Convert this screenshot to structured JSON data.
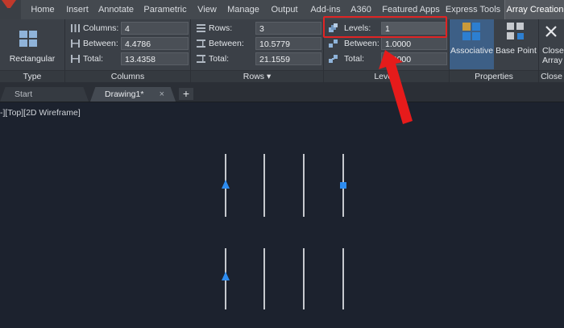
{
  "tabs": [
    {
      "label": "Home"
    },
    {
      "label": "Insert"
    },
    {
      "label": "Annotate"
    },
    {
      "label": "Parametric"
    },
    {
      "label": "View"
    },
    {
      "label": "Manage"
    },
    {
      "label": "Output"
    },
    {
      "label": "Add-ins"
    },
    {
      "label": "A360"
    },
    {
      "label": "Featured Apps"
    },
    {
      "label": "Express Tools"
    },
    {
      "label": "Array Creation"
    }
  ],
  "ribbon": {
    "type": {
      "button_label": "Rectangular",
      "title": "Type"
    },
    "columns": {
      "title": "Columns",
      "fields": [
        {
          "label": "Columns:",
          "value": "4"
        },
        {
          "label": "Between:",
          "value": "4.4786"
        },
        {
          "label": "Total:",
          "value": "13.4358"
        }
      ]
    },
    "rows": {
      "title": "Rows",
      "title_arrow": "▾",
      "fields": [
        {
          "label": "Rows:",
          "value": "3"
        },
        {
          "label": "Between:",
          "value": "10.5779"
        },
        {
          "label": "Total:",
          "value": "21.1559"
        }
      ]
    },
    "levels": {
      "title": "Levels",
      "fields": [
        {
          "label": "Levels:",
          "value": "1"
        },
        {
          "label": "Between:",
          "value": "1.0000"
        },
        {
          "label": "Total:",
          "value": "1.0000"
        }
      ]
    },
    "properties": {
      "title": "Properties",
      "associative_label": "Associative",
      "base_point_label": "Base Point"
    },
    "close": {
      "title": "Close",
      "button_label_1": "Close",
      "button_label_2": "Array"
    }
  },
  "doc_tabs": [
    {
      "label": "Start"
    },
    {
      "label": "Drawing1*"
    }
  ],
  "doc_tab_close": "×",
  "new_tab": "+",
  "viewport": {
    "label": "-][Top][2D Wireframe]"
  },
  "colors": {
    "highlight": "#e02424",
    "grip": "#2d8cf0",
    "ribbon_bg": "#3b4047"
  },
  "icons": [
    "rectangular-array-icon",
    "columns-icon",
    "rows-icon",
    "levels-icon",
    "associative-icon",
    "base-point-icon",
    "close-x-icon"
  ]
}
